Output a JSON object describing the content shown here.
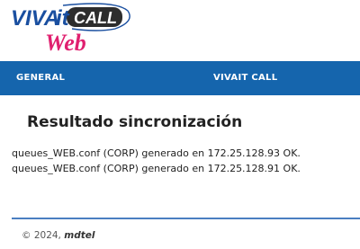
{
  "logo": {
    "text_top": "VIVAit CALL",
    "text_viva": "VIVA",
    "text_it": "it",
    "text_call": "CALL",
    "text_bottom": "Web"
  },
  "nav": {
    "items": [
      {
        "label": "GENERAL"
      },
      {
        "label": "VIVAIT CALL"
      }
    ]
  },
  "main": {
    "title": "Resultado sincronización",
    "results": [
      "queues_WEB.conf (CORP) generado en 172.25.128.93 OK.",
      "queues_WEB.conf (CORP) generado en 172.25.128.91 OK."
    ]
  },
  "footer": {
    "copyright": "© 2024,",
    "brand": "mdtel"
  },
  "colors": {
    "nav_bg": "#1565ad",
    "logo_blue": "#1a4fa0",
    "logo_pink": "#e0206f",
    "divider": "#4a7fc1"
  }
}
